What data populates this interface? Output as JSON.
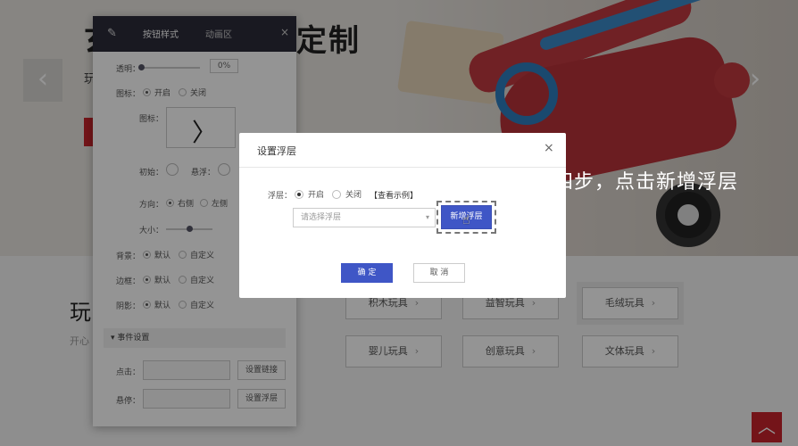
{
  "hero": {
    "title_left": "玄",
    "title_right": "定制",
    "subtitle": "玩",
    "arrow_left": "‹",
    "arrow_right": "›"
  },
  "section": {
    "title": "玩",
    "subtitle": "开心"
  },
  "categories": [
    {
      "label": "积木玩具",
      "chevron": "›"
    },
    {
      "label": "益智玩具",
      "chevron": "›"
    },
    {
      "label": "毛绒玩具",
      "chevron": "›"
    },
    {
      "label": "婴儿玩具",
      "chevron": "›"
    },
    {
      "label": "创意玩具",
      "chevron": "›"
    },
    {
      "label": "文体玩具",
      "chevron": "›"
    }
  ],
  "back_to_top": "︿",
  "panel": {
    "tabs": [
      "按钮样式",
      "动画区"
    ],
    "close": "×",
    "opacity_label": "透明：",
    "opacity_value": "0%",
    "opacity_level": 0.0,
    "icon_label": "图标：",
    "icon_on": "开启",
    "icon_off": "关闭",
    "icon_preview_label": "图标：",
    "icon_preview_glyph": "〉",
    "initial_label": "初始：",
    "hover_label": "悬浮：",
    "direction_label": "方向：",
    "direction_right": "右侧",
    "direction_left": "左侧",
    "size_label": "大小：",
    "size_level": 0.5,
    "bg_label": "背景：",
    "border_label": "边框：",
    "shadow_label": "阴影：",
    "default": "默认",
    "custom": "自定义",
    "events_section": "事件设置",
    "click_label": "点击：",
    "click_button": "设置链接",
    "hover_event_label": "悬停：",
    "hover_button": "设置浮层"
  },
  "modal": {
    "title": "设置浮层",
    "close": "×",
    "float_label": "浮层：",
    "on": "开启",
    "off": "关闭",
    "example_link": "【查看示例】",
    "select_placeholder": "请选择浮层",
    "add_button": "新增浮层",
    "ok_button": "确 定",
    "cancel_button": "取 消"
  },
  "annotation": "第四步，点击新增浮层",
  "colors": {
    "primary": "#3f56c6",
    "brand_red": "#c8242b",
    "panel_header": "#2b2b3a"
  }
}
